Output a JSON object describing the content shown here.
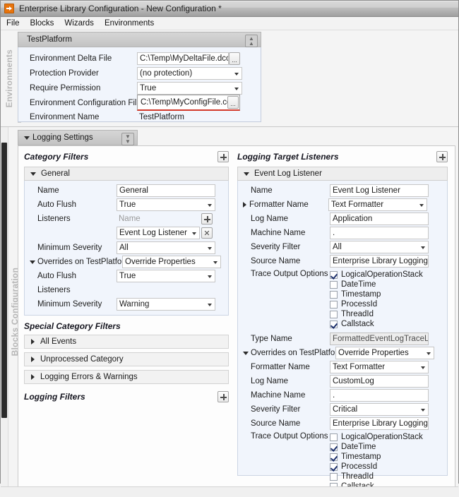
{
  "window": {
    "title": "Enterprise Library Configuration - New Configuration *",
    "app_icon": "enterprise-library-icon"
  },
  "menubar": {
    "items": [
      {
        "label": "File"
      },
      {
        "label": "Blocks"
      },
      {
        "label": "Wizards"
      },
      {
        "label": "Environments"
      }
    ]
  },
  "sidebar": {
    "environments_label": "Environments",
    "blocks_label": "Blocks Configuration"
  },
  "environment": {
    "header": {
      "title": "TestPlatform",
      "collapse_icon": "double-chevron-up-icon"
    },
    "rows": [
      {
        "name": "Environment Delta File",
        "value": "C:\\Temp\\MyDeltaFile.dconfig",
        "control": "textbox-browse"
      },
      {
        "name": "Protection Provider",
        "value": "(no protection)",
        "control": "combobox"
      },
      {
        "name": "Require Permission",
        "value": "True",
        "control": "combobox"
      },
      {
        "name": "Environment Configuration File",
        "value": "C:\\Temp\\MyConfigFile.config",
        "control": "textbox-browse",
        "invalid": true
      },
      {
        "name": "Environment Name",
        "value": "TestPlatform",
        "control": "textbox-plain"
      }
    ],
    "browse_label": "..."
  },
  "logging": {
    "header": {
      "title": "Logging Settings",
      "expand_icon": "double-chevron-down-icon"
    },
    "category_filters": {
      "title": "Category Filters",
      "add_label": "add-icon",
      "general": {
        "header": "General",
        "rows": [
          {
            "name": "Name",
            "value": "General",
            "control": "textbox"
          },
          {
            "name": "Auto Flush",
            "value": "True",
            "control": "combobox"
          },
          {
            "name": "Listeners",
            "value": "",
            "control": "listeners"
          },
          {
            "name": "Minimum Severity",
            "value": "All",
            "control": "combobox"
          }
        ],
        "listeners": {
          "placeholder": "Name",
          "entries": [
            {
              "value": "Event Log Listener"
            }
          ],
          "add_label": "add-icon",
          "remove_label": "✕"
        },
        "overrides": {
          "name": "Overrides on TestPlatform",
          "value": "Override Properties",
          "rows": [
            {
              "name": "Auto Flush",
              "value": "True",
              "control": "combobox"
            },
            {
              "name": "Listeners",
              "value": "",
              "control": "blank"
            },
            {
              "name": "Minimum Severity",
              "value": "Warning",
              "control": "combobox"
            }
          ]
        }
      }
    },
    "special_category_filters": {
      "title": "Special Category Filters",
      "items": [
        {
          "label": "All Events"
        },
        {
          "label": "Unprocessed Category"
        },
        {
          "label": "Logging Errors & Warnings"
        }
      ]
    },
    "logging_filters": {
      "title": "Logging Filters",
      "add_label": "add-icon"
    },
    "target_listeners": {
      "title": "Logging Target Listeners",
      "add_label": "add-icon",
      "listener": {
        "header": "Event Log Listener",
        "rows": [
          {
            "name": "Name",
            "value": "Event Log Listener",
            "control": "textbox"
          },
          {
            "name": "Formatter Name",
            "value": "Text Formatter",
            "control": "combobox",
            "expander": "right"
          },
          {
            "name": "Log Name",
            "value": "Application",
            "control": "textbox"
          },
          {
            "name": "Machine Name",
            "value": ".",
            "control": "textbox"
          },
          {
            "name": "Severity Filter",
            "value": "All",
            "control": "combobox"
          },
          {
            "name": "Source Name",
            "value": "Enterprise Library Logging",
            "control": "textbox"
          }
        ],
        "trace_output_options": {
          "name": "Trace Output Options",
          "options": [
            {
              "label": "LogicalOperationStack",
              "checked": true
            },
            {
              "label": "DateTime",
              "checked": false
            },
            {
              "label": "Timestamp",
              "checked": false
            },
            {
              "label": "ProcessId",
              "checked": false
            },
            {
              "label": "ThreadId",
              "checked": false
            },
            {
              "label": "Callstack",
              "checked": true
            }
          ]
        },
        "type_name": {
          "name": "Type Name",
          "value": "FormattedEventLogTraceListen",
          "readonly": true
        },
        "overrides": {
          "name": "Overrides on TestPlatform",
          "value": "Override Properties",
          "rows": [
            {
              "name": "Formatter Name",
              "value": "Text Formatter",
              "control": "combobox"
            },
            {
              "name": "Log Name",
              "value": "CustomLog",
              "control": "textbox"
            },
            {
              "name": "Machine Name",
              "value": ".",
              "control": "textbox"
            },
            {
              "name": "Severity Filter",
              "value": "Critical",
              "control": "combobox"
            },
            {
              "name": "Source Name",
              "value": "Enterprise Library Logging",
              "control": "textbox"
            }
          ],
          "trace_output_options": {
            "name": "Trace Output Options",
            "options": [
              {
                "label": "LogicalOperationStack",
                "checked": false
              },
              {
                "label": "DateTime",
                "checked": true
              },
              {
                "label": "Timestamp",
                "checked": true
              },
              {
                "label": "ProcessId",
                "checked": true
              },
              {
                "label": "ThreadId",
                "checked": false
              },
              {
                "label": "Callstack",
                "checked": false
              }
            ]
          }
        }
      }
    }
  }
}
